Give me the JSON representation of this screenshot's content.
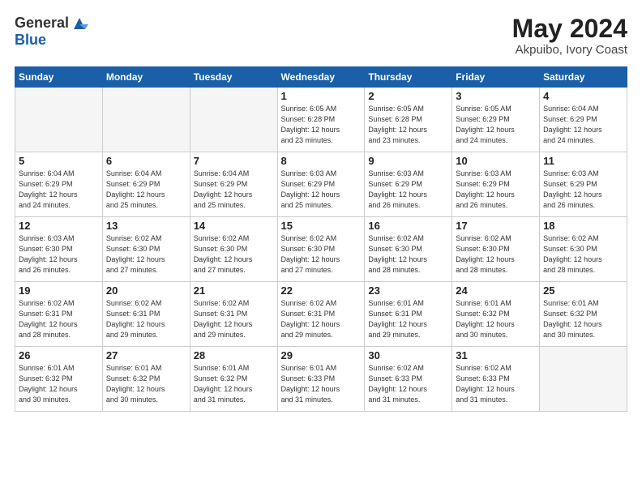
{
  "header": {
    "logo_general": "General",
    "logo_blue": "Blue",
    "month_year": "May 2024",
    "location": "Akpuibo, Ivory Coast"
  },
  "weekdays": [
    "Sunday",
    "Monday",
    "Tuesday",
    "Wednesday",
    "Thursday",
    "Friday",
    "Saturday"
  ],
  "weeks": [
    [
      {
        "day": "",
        "info": ""
      },
      {
        "day": "",
        "info": ""
      },
      {
        "day": "",
        "info": ""
      },
      {
        "day": "1",
        "info": "Sunrise: 6:05 AM\nSunset: 6:28 PM\nDaylight: 12 hours\nand 23 minutes."
      },
      {
        "day": "2",
        "info": "Sunrise: 6:05 AM\nSunset: 6:28 PM\nDaylight: 12 hours\nand 23 minutes."
      },
      {
        "day": "3",
        "info": "Sunrise: 6:05 AM\nSunset: 6:29 PM\nDaylight: 12 hours\nand 24 minutes."
      },
      {
        "day": "4",
        "info": "Sunrise: 6:04 AM\nSunset: 6:29 PM\nDaylight: 12 hours\nand 24 minutes."
      }
    ],
    [
      {
        "day": "5",
        "info": "Sunrise: 6:04 AM\nSunset: 6:29 PM\nDaylight: 12 hours\nand 24 minutes."
      },
      {
        "day": "6",
        "info": "Sunrise: 6:04 AM\nSunset: 6:29 PM\nDaylight: 12 hours\nand 25 minutes."
      },
      {
        "day": "7",
        "info": "Sunrise: 6:04 AM\nSunset: 6:29 PM\nDaylight: 12 hours\nand 25 minutes."
      },
      {
        "day": "8",
        "info": "Sunrise: 6:03 AM\nSunset: 6:29 PM\nDaylight: 12 hours\nand 25 minutes."
      },
      {
        "day": "9",
        "info": "Sunrise: 6:03 AM\nSunset: 6:29 PM\nDaylight: 12 hours\nand 26 minutes."
      },
      {
        "day": "10",
        "info": "Sunrise: 6:03 AM\nSunset: 6:29 PM\nDaylight: 12 hours\nand 26 minutes."
      },
      {
        "day": "11",
        "info": "Sunrise: 6:03 AM\nSunset: 6:29 PM\nDaylight: 12 hours\nand 26 minutes."
      }
    ],
    [
      {
        "day": "12",
        "info": "Sunrise: 6:03 AM\nSunset: 6:30 PM\nDaylight: 12 hours\nand 26 minutes."
      },
      {
        "day": "13",
        "info": "Sunrise: 6:02 AM\nSunset: 6:30 PM\nDaylight: 12 hours\nand 27 minutes."
      },
      {
        "day": "14",
        "info": "Sunrise: 6:02 AM\nSunset: 6:30 PM\nDaylight: 12 hours\nand 27 minutes."
      },
      {
        "day": "15",
        "info": "Sunrise: 6:02 AM\nSunset: 6:30 PM\nDaylight: 12 hours\nand 27 minutes."
      },
      {
        "day": "16",
        "info": "Sunrise: 6:02 AM\nSunset: 6:30 PM\nDaylight: 12 hours\nand 28 minutes."
      },
      {
        "day": "17",
        "info": "Sunrise: 6:02 AM\nSunset: 6:30 PM\nDaylight: 12 hours\nand 28 minutes."
      },
      {
        "day": "18",
        "info": "Sunrise: 6:02 AM\nSunset: 6:30 PM\nDaylight: 12 hours\nand 28 minutes."
      }
    ],
    [
      {
        "day": "19",
        "info": "Sunrise: 6:02 AM\nSunset: 6:31 PM\nDaylight: 12 hours\nand 28 minutes."
      },
      {
        "day": "20",
        "info": "Sunrise: 6:02 AM\nSunset: 6:31 PM\nDaylight: 12 hours\nand 29 minutes."
      },
      {
        "day": "21",
        "info": "Sunrise: 6:02 AM\nSunset: 6:31 PM\nDaylight: 12 hours\nand 29 minutes."
      },
      {
        "day": "22",
        "info": "Sunrise: 6:02 AM\nSunset: 6:31 PM\nDaylight: 12 hours\nand 29 minutes."
      },
      {
        "day": "23",
        "info": "Sunrise: 6:01 AM\nSunset: 6:31 PM\nDaylight: 12 hours\nand 29 minutes."
      },
      {
        "day": "24",
        "info": "Sunrise: 6:01 AM\nSunset: 6:32 PM\nDaylight: 12 hours\nand 30 minutes."
      },
      {
        "day": "25",
        "info": "Sunrise: 6:01 AM\nSunset: 6:32 PM\nDaylight: 12 hours\nand 30 minutes."
      }
    ],
    [
      {
        "day": "26",
        "info": "Sunrise: 6:01 AM\nSunset: 6:32 PM\nDaylight: 12 hours\nand 30 minutes."
      },
      {
        "day": "27",
        "info": "Sunrise: 6:01 AM\nSunset: 6:32 PM\nDaylight: 12 hours\nand 30 minutes."
      },
      {
        "day": "28",
        "info": "Sunrise: 6:01 AM\nSunset: 6:32 PM\nDaylight: 12 hours\nand 31 minutes."
      },
      {
        "day": "29",
        "info": "Sunrise: 6:01 AM\nSunset: 6:33 PM\nDaylight: 12 hours\nand 31 minutes."
      },
      {
        "day": "30",
        "info": "Sunrise: 6:02 AM\nSunset: 6:33 PM\nDaylight: 12 hours\nand 31 minutes."
      },
      {
        "day": "31",
        "info": "Sunrise: 6:02 AM\nSunset: 6:33 PM\nDaylight: 12 hours\nand 31 minutes."
      },
      {
        "day": "",
        "info": ""
      }
    ]
  ]
}
